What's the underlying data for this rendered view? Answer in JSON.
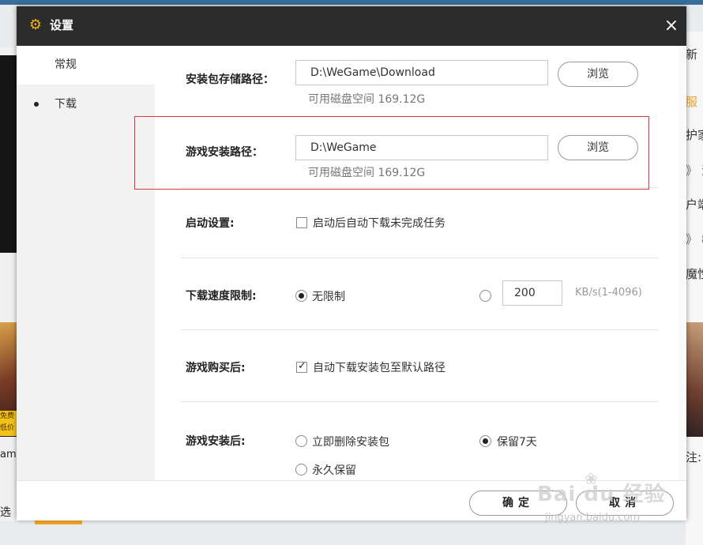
{
  "background": {
    "left_promo_text": "免费 低价",
    "left_text": "am",
    "left_text2": "选",
    "right_items": [
      "新",
      "服",
      "护家",
      "》 消",
      "户端",
      "》 8",
      "魔性",
      "注:"
    ]
  },
  "dialog": {
    "title": "设置",
    "close_label": "×",
    "sidebar": {
      "items": [
        {
          "label": "常规"
        },
        {
          "label": "下载"
        }
      ]
    },
    "download": {
      "package_path_label": "安装包存储路径：",
      "package_path_value": "D:\\WeGame\\Download",
      "package_free_space": "可用磁盘空间 169.12G",
      "browse_label": "浏览",
      "game_path_label": "游戏安装路径：",
      "game_path_value": "D:\\WeGame",
      "game_free_space": "可用磁盘空间 169.12G",
      "startup_label": "启动设置:",
      "startup_option": "启动后自动下载未完成任务",
      "speed_label": "下载速度限制:",
      "speed_unlimited": "无限制",
      "speed_value": "200",
      "speed_unit": "KB/s(1-4096)",
      "purchase_label": "游戏购买后:",
      "purchase_option": "自动下载安装包至默认路径",
      "after_install_label": "游戏安装后:",
      "after_install_delete": "立即删除安装包",
      "after_install_keep7": "保留7天",
      "after_install_forever": "永久保留"
    },
    "footer": {
      "confirm_label": "确定",
      "cancel_label": "取消"
    }
  },
  "watermark": {
    "text": "Bai du 经验",
    "sub": "jingyan.baidu.com"
  },
  "colors": {
    "titlebar": "#2b2b2b",
    "title_icon": "#f5b21c",
    "highlight_box": "#d9383a"
  }
}
